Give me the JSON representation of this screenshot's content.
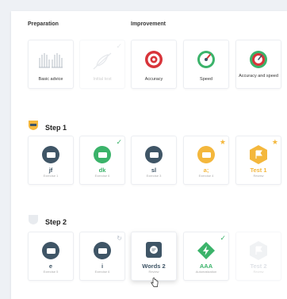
{
  "colors": {
    "dark": "#3f5566",
    "green": "#3bb36a",
    "yellow": "#f4b73c",
    "red": "#d8343a"
  },
  "sections": {
    "preparation": "Preparation",
    "improvement": "Improvement"
  },
  "top_cards": [
    {
      "caption": "Basic advice",
      "icon": "hands-icon",
      "faded": false
    },
    {
      "caption": "Initial test",
      "icon": "feather-icon",
      "faded": true,
      "check": true
    },
    {
      "caption": "Accuracy",
      "icon": "target-icon",
      "faded": false
    },
    {
      "caption": "Speed",
      "icon": "speedometer-icon",
      "faded": false
    },
    {
      "caption": "Accuracy and speed",
      "icon": "target-speed-icon",
      "faded": false
    }
  ],
  "step1": {
    "label": "Step 1",
    "exercises": [
      {
        "name": "jf",
        "sub": "Exercise 1",
        "color": "#3f5566"
      },
      {
        "name": "dk",
        "sub": "Exercise 6",
        "color": "#3bb36a",
        "badge": "check"
      },
      {
        "name": "sl",
        "sub": "Exercise 3",
        "color": "#3f5566"
      },
      {
        "name": "a;",
        "sub": "Exercise 4",
        "color": "#f4b73c",
        "badge": "star"
      },
      {
        "name": "Test 1",
        "sub": "Review",
        "color": "#f4b73c",
        "badge": "star"
      }
    ]
  },
  "step2": {
    "label": "Step 2",
    "exercises": [
      {
        "name": "e",
        "sub": "Exercise 5",
        "color": "#3f5566"
      },
      {
        "name": "i",
        "sub": "Exercise 6",
        "color": "#3f5566",
        "badge": "refresh"
      },
      {
        "name": "Words 2",
        "sub": "Review",
        "color": "#3f5566"
      },
      {
        "name": "AAA",
        "sub": "Automatization",
        "color": "#3bb36a",
        "badge": "check"
      },
      {
        "name": "Test 2",
        "sub": "Review",
        "color": "#b9c1cc"
      }
    ]
  }
}
